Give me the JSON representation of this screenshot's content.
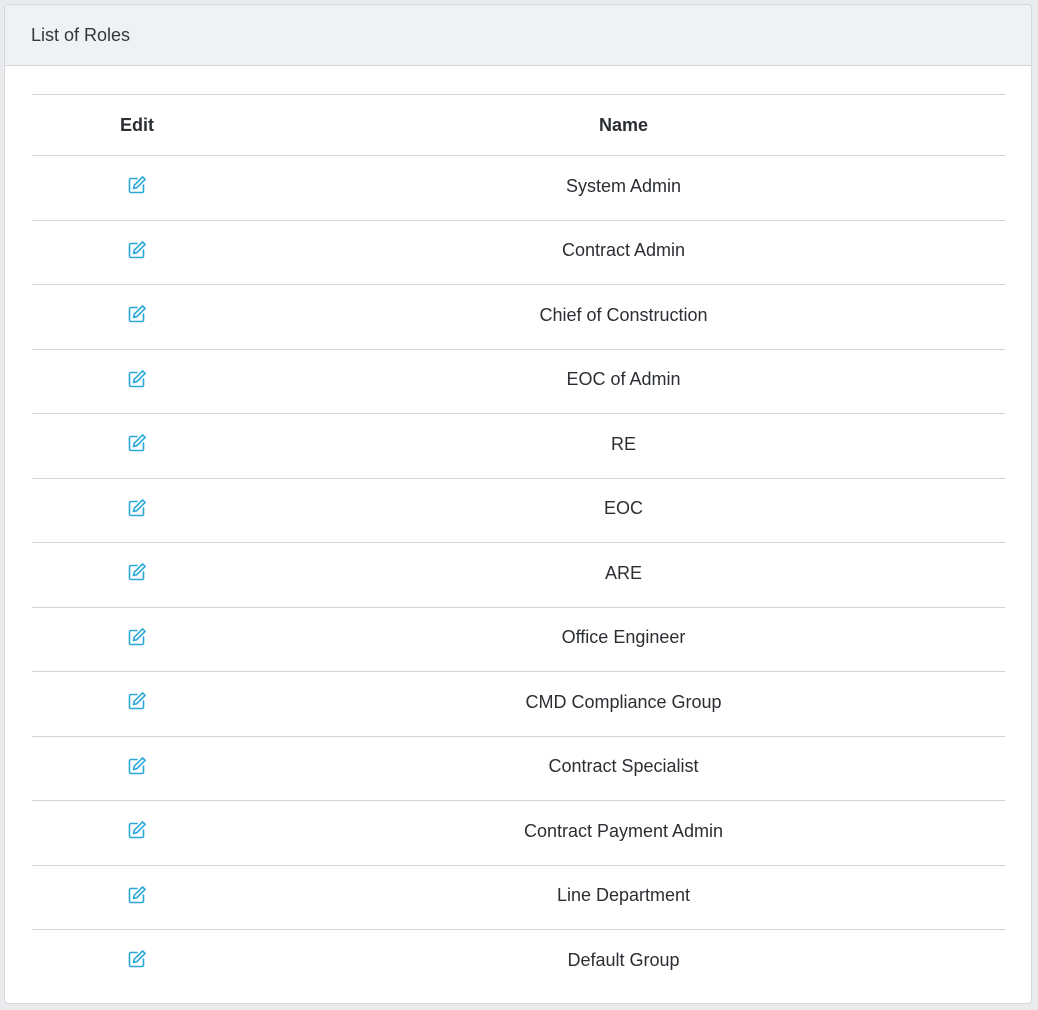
{
  "panel": {
    "title": "List of Roles"
  },
  "table": {
    "columns": {
      "edit": "Edit",
      "name": "Name"
    },
    "rows": [
      {
        "name": "System Admin"
      },
      {
        "name": "Contract Admin"
      },
      {
        "name": "Chief of Construction"
      },
      {
        "name": "EOC of Admin"
      },
      {
        "name": "RE"
      },
      {
        "name": "EOC"
      },
      {
        "name": "ARE"
      },
      {
        "name": "Office Engineer"
      },
      {
        "name": "CMD Compliance Group"
      },
      {
        "name": "Contract Specialist"
      },
      {
        "name": "Contract Payment Admin"
      },
      {
        "name": "Line Department"
      },
      {
        "name": "Default Group"
      }
    ]
  },
  "icons": {
    "edit": "edit-icon"
  },
  "colors": {
    "accent": "#2aa8d8",
    "header_bg": "#eef2f5",
    "border": "#cfd4d8"
  }
}
